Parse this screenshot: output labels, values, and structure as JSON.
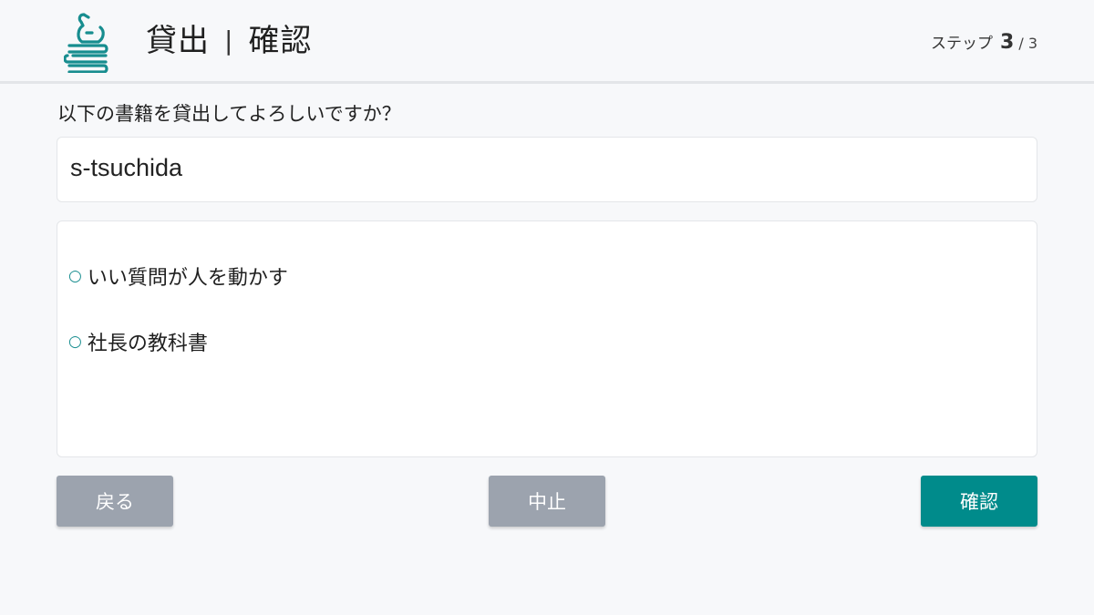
{
  "header": {
    "title_main": "貸出",
    "title_separator": "|",
    "title_sub": "確認",
    "step_label": "ステップ",
    "step_current": "3",
    "step_total": "/ 3",
    "logo_icon": "bird-on-books-icon",
    "accent_color": "#178d8f"
  },
  "question": "以下の書籍を貸出してよろしいですか？",
  "user": {
    "value": "s-tsuchida"
  },
  "books": [
    {
      "bullet": "○",
      "title": "いい質問が人を動かす"
    },
    {
      "bullet": "○",
      "title": "社長の教科書"
    }
  ],
  "buttons": {
    "back": "戻る",
    "cancel": "中止",
    "confirm": "確認"
  },
  "colors": {
    "primary": "#008b8b",
    "secondary": "#9ca3ae",
    "background": "#f7f8fa"
  }
}
